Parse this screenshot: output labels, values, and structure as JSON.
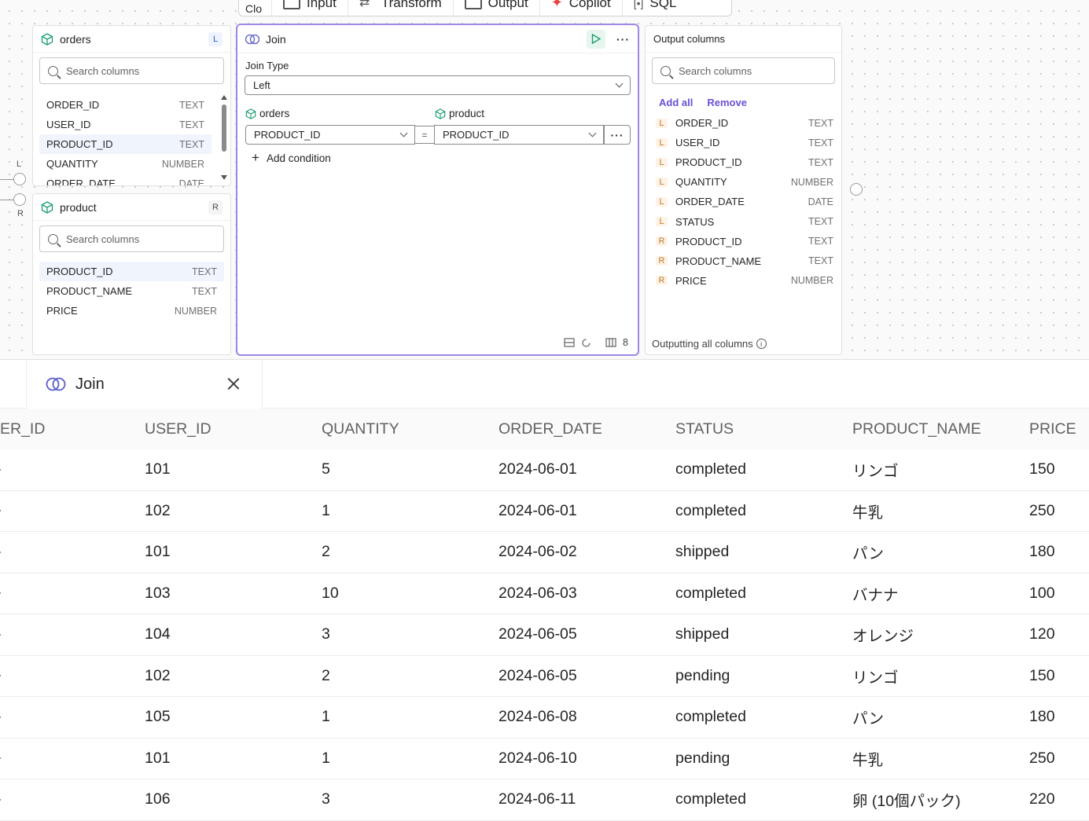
{
  "toolbar": {
    "items": [
      {
        "label": "Clo"
      },
      {
        "label": "Input"
      },
      {
        "label": "Transform"
      },
      {
        "label": "Output"
      },
      {
        "label": "Copilot"
      },
      {
        "label": "SQL"
      }
    ]
  },
  "ports": {
    "left_label": "L",
    "right_label": "R"
  },
  "orders_card": {
    "title": "orders",
    "badge": "L",
    "search_placeholder": "Search columns",
    "columns": [
      {
        "name": "ORDER_ID",
        "type": "TEXT"
      },
      {
        "name": "USER_ID",
        "type": "TEXT"
      },
      {
        "name": "PRODUCT_ID",
        "type": "TEXT"
      },
      {
        "name": "QUANTITY",
        "type": "NUMBER"
      },
      {
        "name": "ORDER_DATE",
        "type": "DATE"
      }
    ]
  },
  "product_card": {
    "title": "product",
    "badge": "R",
    "search_placeholder": "Search columns",
    "columns": [
      {
        "name": "PRODUCT_ID",
        "type": "TEXT"
      },
      {
        "name": "PRODUCT_NAME",
        "type": "TEXT"
      },
      {
        "name": "PRICE",
        "type": "NUMBER"
      }
    ]
  },
  "join_card": {
    "title": "Join",
    "join_type_label": "Join Type",
    "join_type_value": "Left",
    "left_table": "orders",
    "right_table": "product",
    "left_key": "PRODUCT_ID",
    "operator": "=",
    "right_key": "PRODUCT_ID",
    "add_condition": "Add condition",
    "footer_count": "8"
  },
  "output_card": {
    "title": "Output columns",
    "search_placeholder": "Search columns",
    "add_all": "Add all",
    "remove": "Remove",
    "columns": [
      {
        "side": "L",
        "name": "ORDER_ID",
        "type": "TEXT"
      },
      {
        "side": "L",
        "name": "USER_ID",
        "type": "TEXT"
      },
      {
        "side": "L",
        "name": "PRODUCT_ID",
        "type": "TEXT"
      },
      {
        "side": "L",
        "name": "QUANTITY",
        "type": "NUMBER"
      },
      {
        "side": "L",
        "name": "ORDER_DATE",
        "type": "DATE"
      },
      {
        "side": "L",
        "name": "STATUS",
        "type": "TEXT"
      },
      {
        "side": "R",
        "name": "PRODUCT_ID",
        "type": "TEXT"
      },
      {
        "side": "R",
        "name": "PRODUCT_NAME",
        "type": "TEXT"
      },
      {
        "side": "R",
        "name": "PRICE",
        "type": "NUMBER"
      }
    ],
    "footer": "Outputting all columns"
  },
  "results_tab": {
    "label": "Join"
  },
  "results": {
    "headers": [
      "ER_ID",
      "USER_ID",
      "QUANTITY",
      "ORDER_DATE",
      "STATUS",
      "PRODUCT_NAME",
      "PRICE"
    ],
    "rows": [
      [
        "",
        "101",
        "5",
        "2024-06-01",
        "completed",
        "リンゴ",
        "150"
      ],
      [
        "",
        "102",
        "1",
        "2024-06-01",
        "completed",
        "牛乳",
        "250"
      ],
      [
        "",
        "101",
        "2",
        "2024-06-02",
        "shipped",
        "パン",
        "180"
      ],
      [
        "",
        "103",
        "10",
        "2024-06-03",
        "completed",
        "バナナ",
        "100"
      ],
      [
        "",
        "104",
        "3",
        "2024-06-05",
        "shipped",
        "オレンジ",
        "120"
      ],
      [
        "",
        "102",
        "2",
        "2024-06-05",
        "pending",
        "リンゴ",
        "150"
      ],
      [
        "",
        "105",
        "1",
        "2024-06-08",
        "completed",
        "パン",
        "180"
      ],
      [
        "",
        "101",
        "1",
        "2024-06-10",
        "pending",
        "牛乳",
        "250"
      ],
      [
        "",
        "106",
        "3",
        "2024-06-11",
        "completed",
        "卵 (10個パック)",
        "220"
      ]
    ]
  },
  "colors": {
    "accent": "#9f87e8",
    "link": "#6b4fd8",
    "cube": "#1a9e6e",
    "run": "#1a9e6e"
  }
}
